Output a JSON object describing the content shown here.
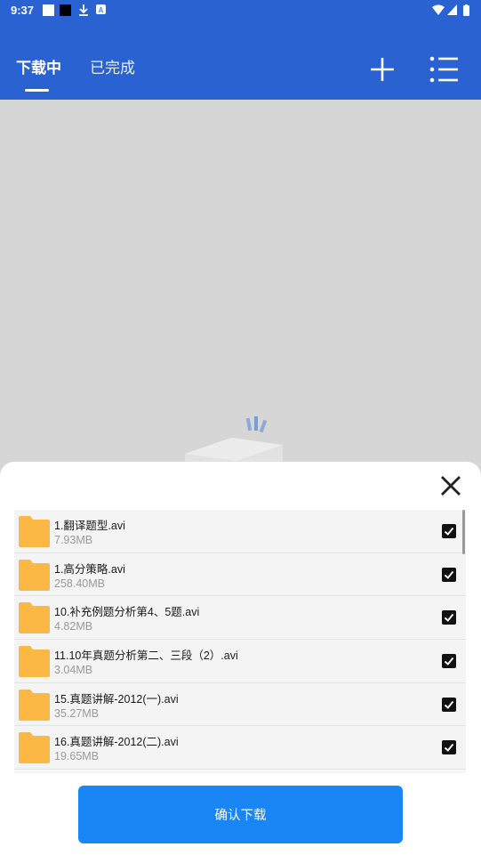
{
  "status_bar": {
    "time": "9:37"
  },
  "tabs": [
    {
      "label": "下载中",
      "active": true
    },
    {
      "label": "已完成",
      "active": false
    }
  ],
  "icons": {
    "add": "add-icon",
    "menu": "list-menu-icon",
    "close": "close-icon",
    "folder": "folder-icon",
    "checkbox": "checkbox-checked-icon"
  },
  "files": [
    {
      "name": "1.翻译题型.avi",
      "size": "7.93MB",
      "checked": true
    },
    {
      "name": "1.高分策略.avi",
      "size": "258.40MB",
      "checked": true
    },
    {
      "name": "10.补充例题分析第4、5题.avi",
      "size": "4.82MB",
      "checked": true
    },
    {
      "name": "11.10年真题分析第二、三段（2）.avi",
      "size": "3.04MB",
      "checked": true
    },
    {
      "name": "15.真题讲解-2012(一).avi",
      "size": "35.27MB",
      "checked": true
    },
    {
      "name": "16.真题讲解-2012(二).avi",
      "size": "19.65MB",
      "checked": true
    }
  ],
  "confirm_label": "确认下载",
  "colors": {
    "app_bar": "#2b62d1",
    "confirm_button": "#1a86f5",
    "folder": "#fbb844",
    "overlay": "#d6d6d6"
  }
}
